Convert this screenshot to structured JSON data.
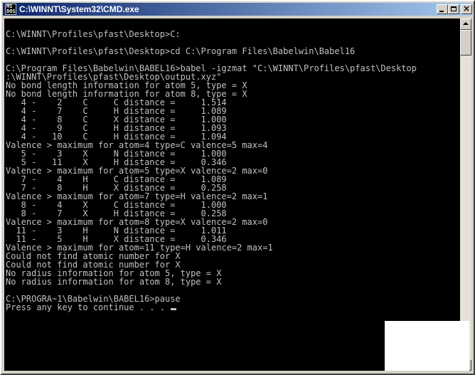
{
  "window": {
    "title": "C:\\WINNT\\System32\\CMD.exe",
    "icon_text": "MS\nDOS",
    "icon_name": "cmd-icon",
    "controls": [
      "minimize-icon",
      "maximize-icon",
      "close-icon"
    ]
  },
  "console": {
    "text_color": "#c0c0c0",
    "background": "#000000",
    "lines": [
      "",
      "C:\\WINNT\\Profiles\\pfast\\Desktop>C:",
      "",
      "C:\\WINNT\\Profiles\\pfast\\Desktop>cd C:\\Program Files\\Babelwin\\Babel16",
      "",
      "C:\\Program Files\\Babelwin\\BABEL16>babel -igzmat \"C:\\WINNT\\Profiles\\pfast\\Desktop",
      ":\\WINNT\\Profiles\\pfast\\Desktop\\output.xyz\"",
      "No bond length information for atom 5, type = X",
      "No bond length information for atom 8, type = X",
      "   4 -    2    C     C distance =     1.514",
      "   4 -    7    C     H distance =     1.089",
      "   4 -    8    C     X distance =     1.000",
      "   4 -    9    C     H distance =     1.093",
      "   4 -   10    C     H distance =     1.094",
      "Valence > maximum for atom=4 type=C valence=5 max=4",
      "   5 -    3    X     N distance =     1.000",
      "   5 -   11    X     H distance =     0.346",
      "Valence > maximum for atom=5 type=X valence=2 max=0",
      "   7 -    4    H     C distance =     1.089",
      "   7 -    8    H     X distance =     0.258",
      "Valence > maximum for atom=7 type=H valence=2 max=1",
      "   8 -    4    X     C distance =     1.000",
      "   8 -    7    X     H distance =     0.258",
      "Valence > maximum for atom=8 type=X valence=2 max=0",
      "  11 -    3    H     N distance =     1.011",
      "  11 -    5    H     X distance =     0.346",
      "Valence > maximum for atom=11 type=H valence=2 max=1",
      "Could not find atomic number for X",
      "Could not find atomic number for X",
      "No radius information for atom 5, type = X",
      "No radius information for atom 8, type = X",
      "",
      "C:\\PROGRA~1\\Babelwin\\BABEL16>pause",
      "Press any key to continue . . . "
    ]
  }
}
